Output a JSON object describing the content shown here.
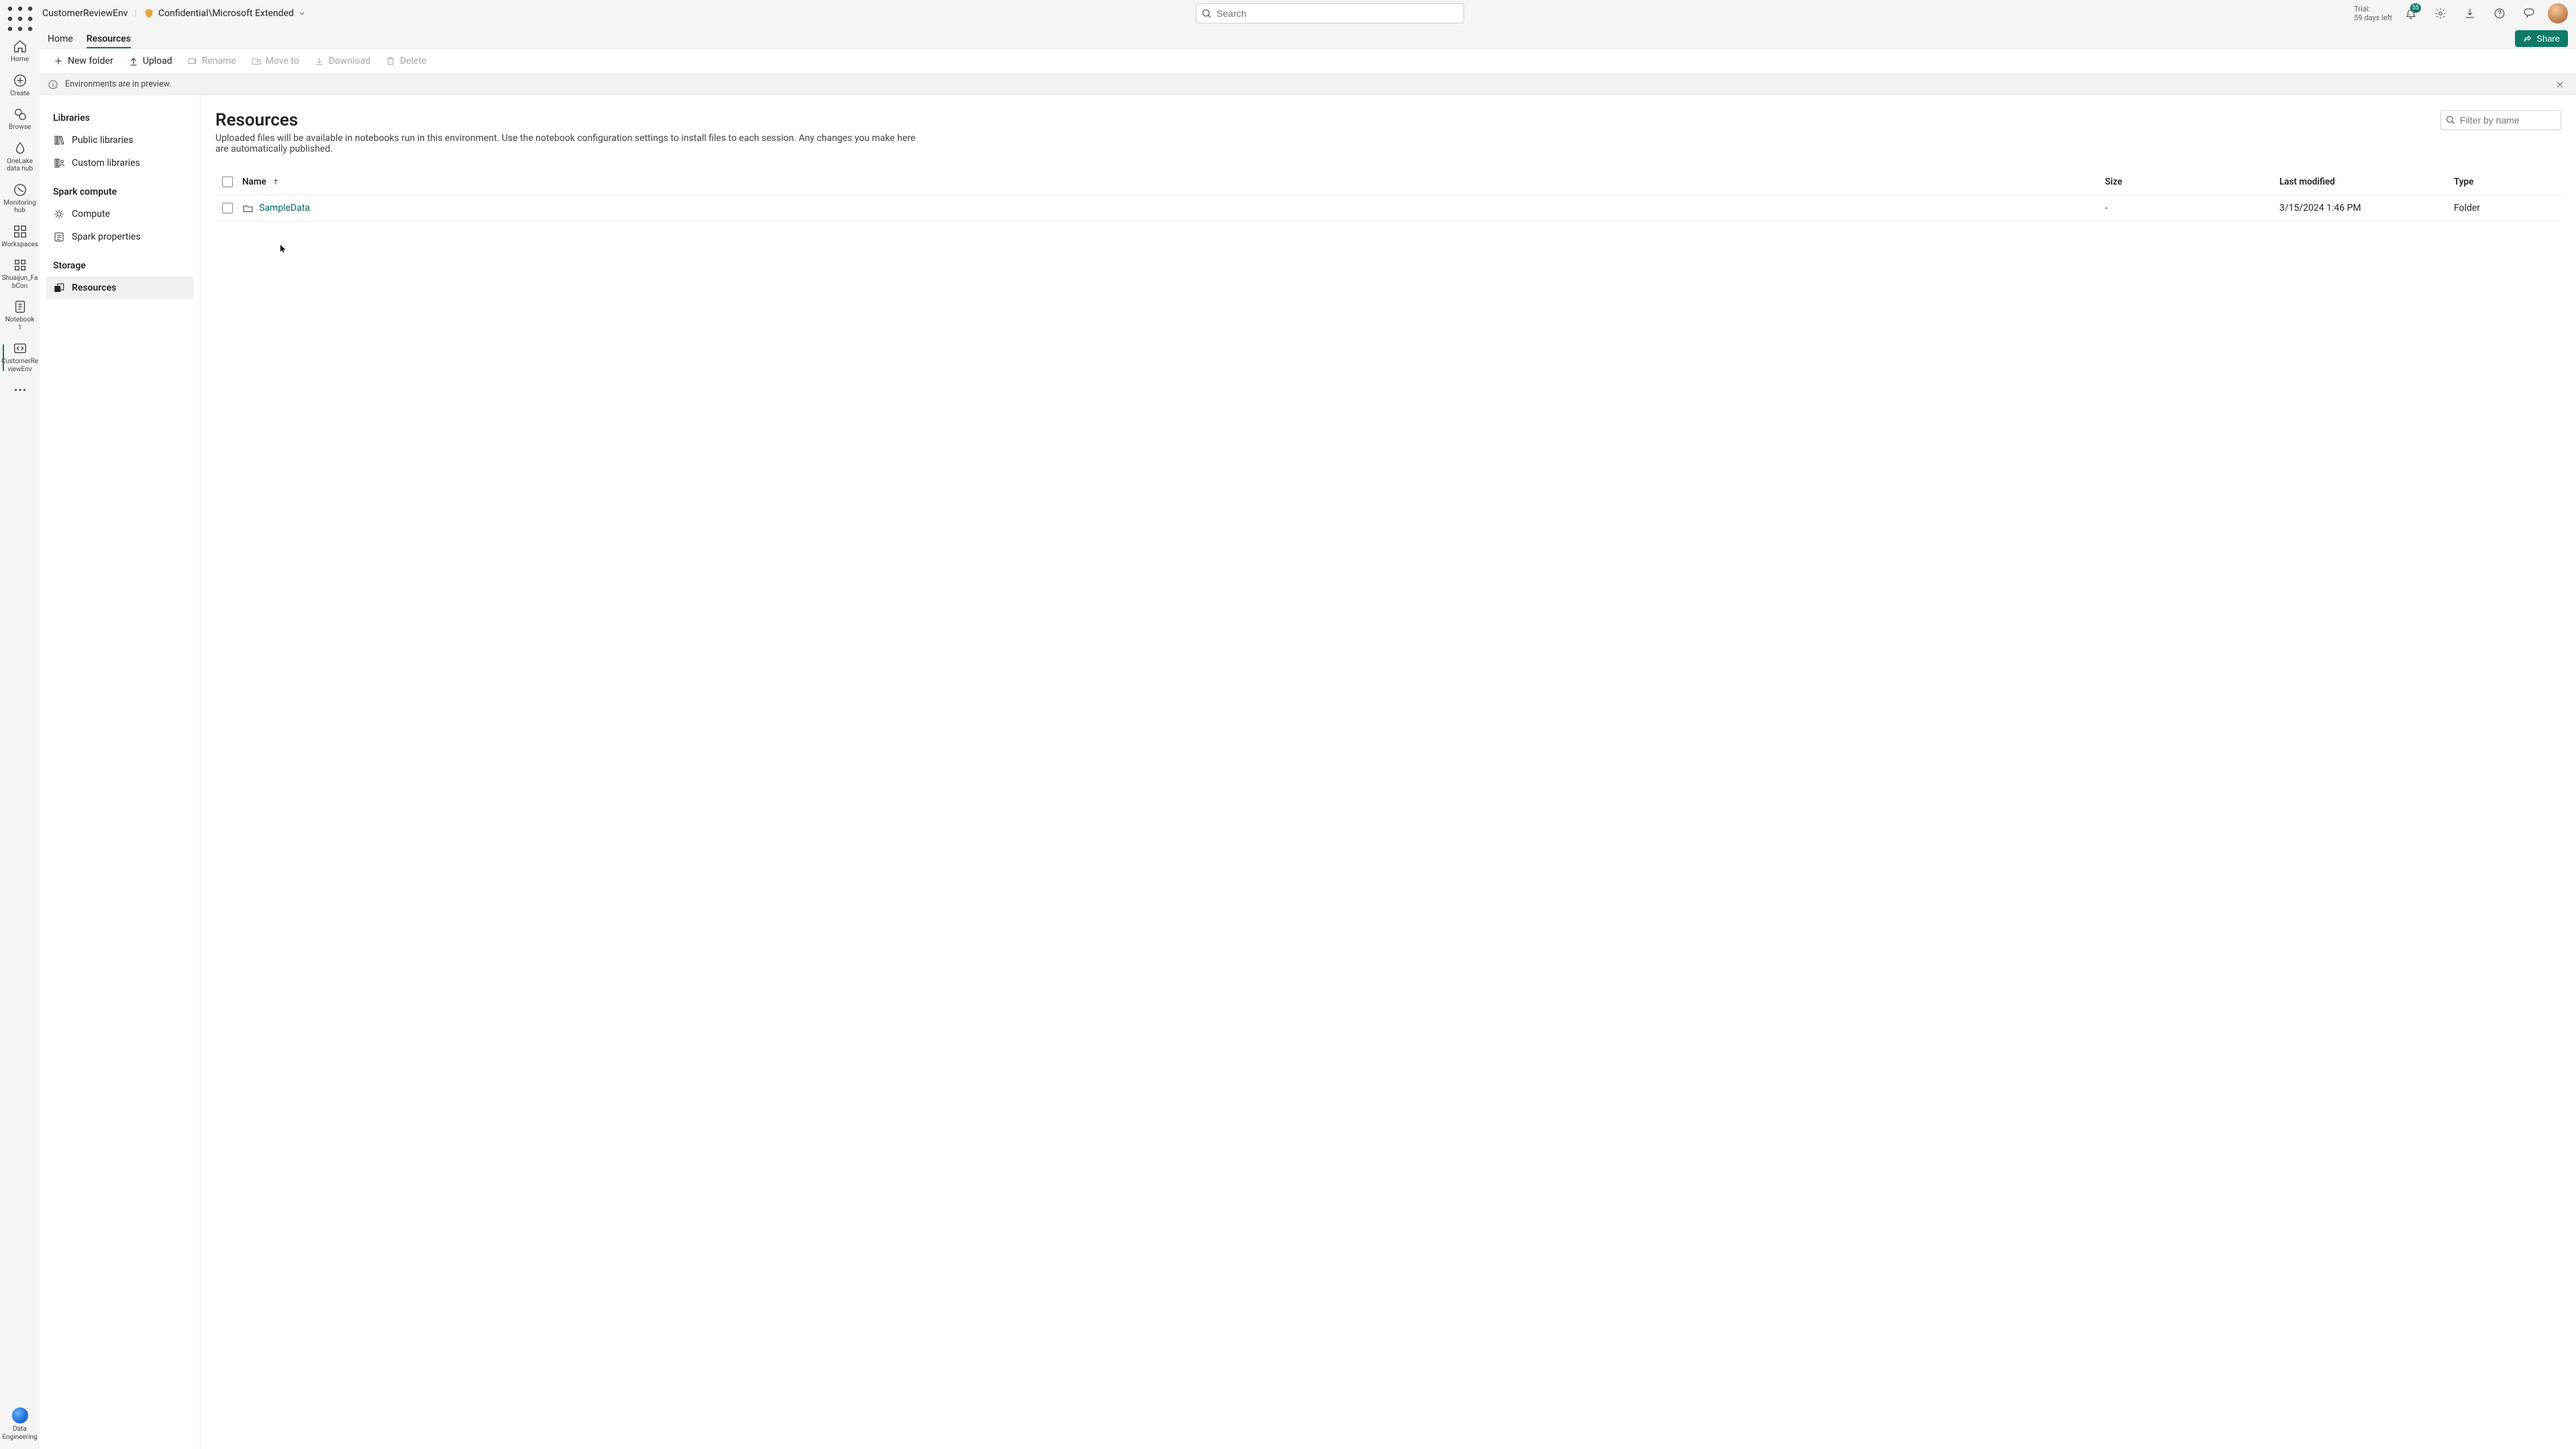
{
  "header": {
    "breadcrumb_title": "CustomerReviewEnv",
    "sensitivity_label": "Confidential\\Microsoft Extended",
    "search_placeholder": "Search",
    "trial_line1": "Trial:",
    "trial_line2": "59 days left",
    "notification_count": "55",
    "share_label": "Share"
  },
  "tabs": [
    {
      "label": "Home",
      "active": false
    },
    {
      "label": "Resources",
      "active": true
    }
  ],
  "toolbar": {
    "new_folder": "New folder",
    "upload": "Upload",
    "rename": "Rename",
    "move_to": "Move to",
    "download": "Download",
    "delete": "Delete"
  },
  "banner": {
    "text": "Environments are in preview."
  },
  "rail": {
    "home": "Home",
    "create": "Create",
    "browse": "Browse",
    "onelake": "OneLake data hub",
    "monitoring": "Monitoring hub",
    "workspaces": "Workspaces",
    "workspace_item": "Shuaijun_Fa bCon",
    "notebook": "Notebook 1",
    "env": "CustomerRe viewEnv",
    "persona": "Data Engineering"
  },
  "sidepanel": {
    "sections": {
      "libraries": "Libraries",
      "spark": "Spark compute",
      "storage": "Storage"
    },
    "items": {
      "public_libs": "Public libraries",
      "custom_libs": "Custom libraries",
      "compute": "Compute",
      "spark_props": "Spark properties",
      "resources": "Resources"
    }
  },
  "main": {
    "title": "Resources",
    "description": "Uploaded files will be available in notebooks run in this environment. Use the notebook configuration settings to install files to each session. Any changes you make here are automatically published.",
    "filter_placeholder": "Filter by name",
    "columns": {
      "name": "Name",
      "size": "Size",
      "modified": "Last modified",
      "type": "Type"
    },
    "rows": [
      {
        "name": "SampleData",
        "size": "-",
        "modified": "3/15/2024 1:46 PM",
        "type": "Folder"
      }
    ]
  }
}
